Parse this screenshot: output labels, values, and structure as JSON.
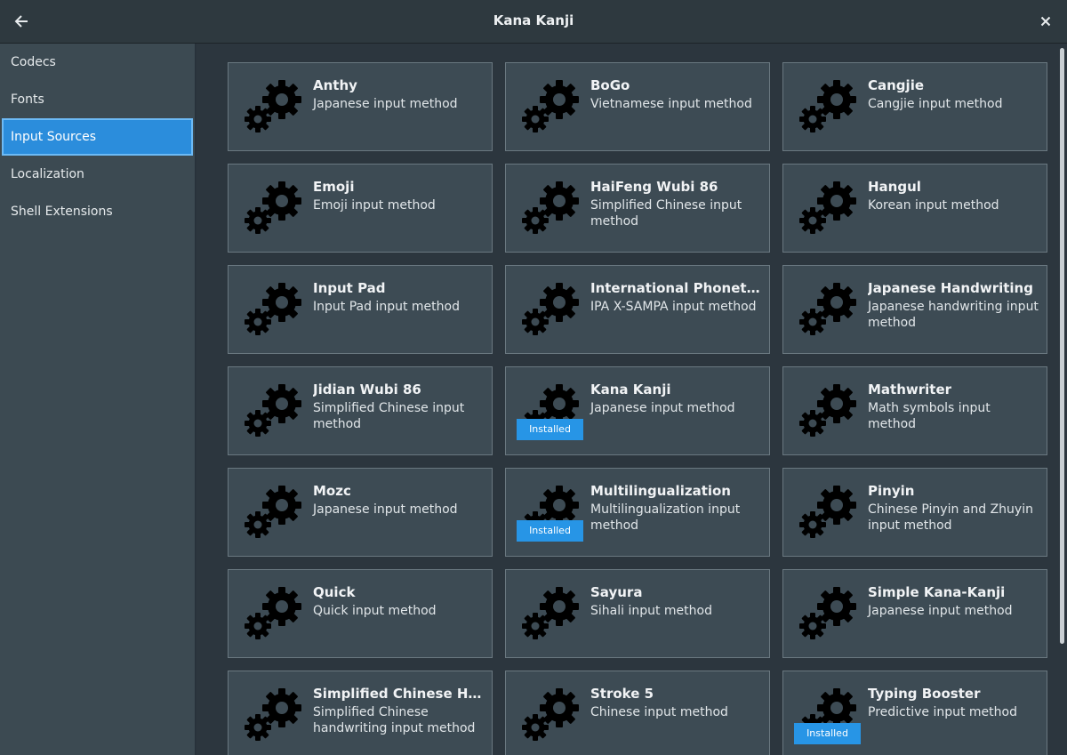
{
  "header": {
    "title": "Kana Kanji",
    "back_icon": "arrow-left-icon",
    "close_icon": "close-icon"
  },
  "sidebar": {
    "items": [
      {
        "label": "Codecs",
        "active": false
      },
      {
        "label": "Fonts",
        "active": false
      },
      {
        "label": "Input Sources",
        "active": true
      },
      {
        "label": "Localization",
        "active": false
      },
      {
        "label": "Shell Extensions",
        "active": false
      }
    ]
  },
  "colors": {
    "accent": "#2b8ddc",
    "badge": "#2795e6",
    "card_bg": "#3d4b54",
    "sidebar_bg": "#3c4a52"
  },
  "cards": [
    {
      "name": "Anthy",
      "desc": "Japanese input method",
      "installed": false
    },
    {
      "name": "BoGo",
      "desc": "Vietnamese input method",
      "installed": false
    },
    {
      "name": "Cangjie",
      "desc": "Cangjie input method",
      "installed": false
    },
    {
      "name": "Emoji",
      "desc": "Emoji input method",
      "installed": false
    },
    {
      "name": "HaiFeng Wubi 86",
      "desc": "Simplified Chinese input method",
      "installed": false
    },
    {
      "name": "Hangul",
      "desc": "Korean input method",
      "installed": false
    },
    {
      "name": "Input Pad",
      "desc": "Input Pad input method",
      "installed": false
    },
    {
      "name": "International Phonetic…",
      "desc": "IPA X-SAMPA input method",
      "installed": false
    },
    {
      "name": "Japanese Handwriting",
      "desc": "Japanese handwriting input method",
      "installed": false
    },
    {
      "name": "Jidian Wubi 86",
      "desc": "Simplified Chinese input method",
      "installed": false
    },
    {
      "name": "Kana Kanji",
      "desc": "Japanese input method",
      "installed": true
    },
    {
      "name": "Mathwriter",
      "desc": "Math symbols input method",
      "installed": false
    },
    {
      "name": "Mozc",
      "desc": "Japanese input method",
      "installed": false
    },
    {
      "name": "Multilingualization",
      "desc": "Multilingualization input method",
      "installed": true
    },
    {
      "name": "Pinyin",
      "desc": "Chinese Pinyin and Zhuyin input method",
      "installed": false
    },
    {
      "name": "Quick",
      "desc": "Quick input method",
      "installed": false
    },
    {
      "name": "Sayura",
      "desc": "Sihali input method",
      "installed": false
    },
    {
      "name": "Simple Kana-Kanji",
      "desc": "Japanese input method",
      "installed": false
    },
    {
      "name": "Simplified Chinese Ha…",
      "desc": "Simplified Chinese handwriting input method",
      "installed": false
    },
    {
      "name": "Stroke 5",
      "desc": "Chinese input method",
      "installed": false
    },
    {
      "name": "Typing Booster",
      "desc": "Predictive input method",
      "installed": true
    }
  ],
  "badge_label": "Installed",
  "card_icon": "gears-icon"
}
